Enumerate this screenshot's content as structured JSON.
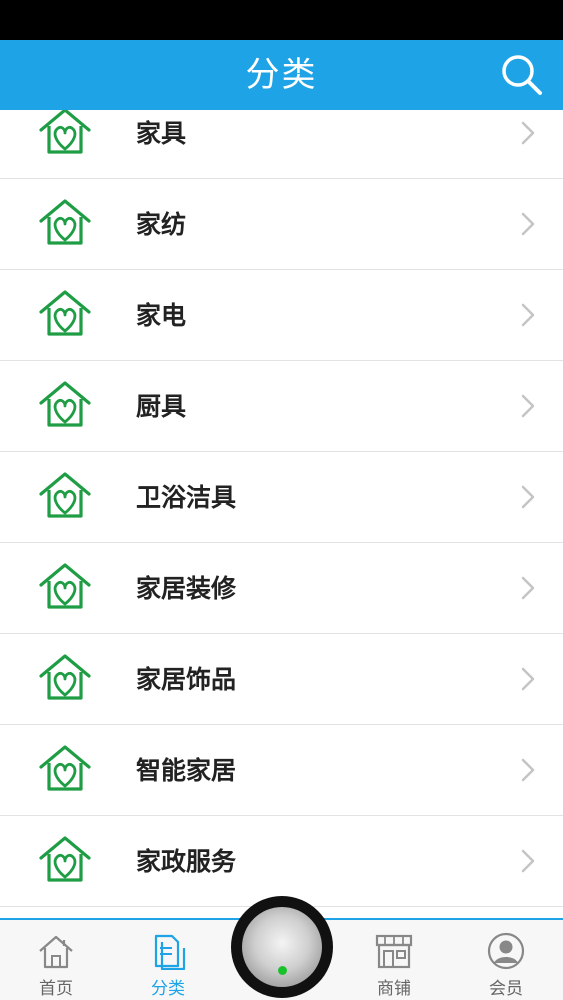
{
  "header": {
    "title": "分类"
  },
  "colors": {
    "accent": "#1ea3e6",
    "icon_green": "#1f9d45",
    "knob_indicator": "#19c22a"
  },
  "categories": [
    {
      "label": "家具",
      "icon": "home-heart-icon"
    },
    {
      "label": "家纺",
      "icon": "home-heart-icon"
    },
    {
      "label": "家电",
      "icon": "home-heart-icon"
    },
    {
      "label": "厨具",
      "icon": "home-heart-icon"
    },
    {
      "label": "卫浴洁具",
      "icon": "home-heart-icon"
    },
    {
      "label": "家居装修",
      "icon": "home-heart-icon"
    },
    {
      "label": "家居饰品",
      "icon": "home-heart-icon"
    },
    {
      "label": "智能家居",
      "icon": "home-heart-icon"
    },
    {
      "label": "家政服务",
      "icon": "home-heart-icon"
    }
  ],
  "tabbar": {
    "items": [
      {
        "label": "首页",
        "icon": "house-icon",
        "active": false
      },
      {
        "label": "分类",
        "icon": "documents-icon",
        "active": true
      },
      {
        "label": "商铺",
        "icon": "storefront-icon",
        "active": false
      },
      {
        "label": "会员",
        "icon": "user-avatar-icon",
        "active": false
      }
    ]
  }
}
